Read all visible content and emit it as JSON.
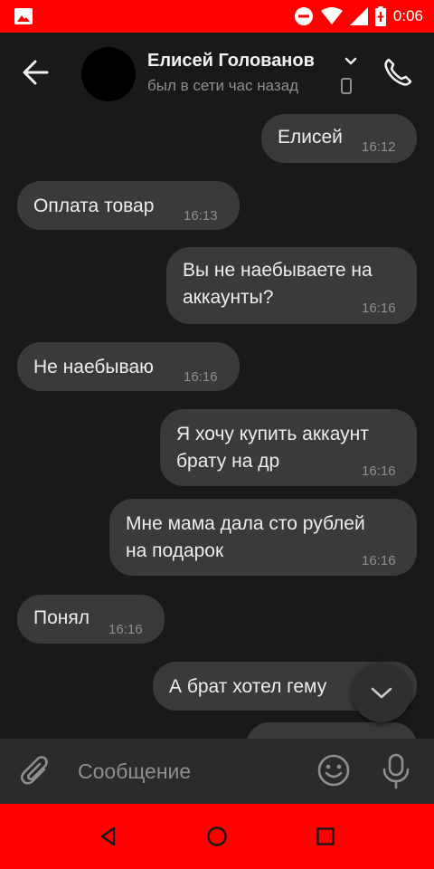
{
  "status_bar": {
    "time": "0:06",
    "icons": [
      "gallery-icon",
      "do-not-disturb-icon",
      "wifi-icon",
      "signal-icon",
      "battery-icon"
    ]
  },
  "header": {
    "contact_name": "Елисей Голованов",
    "contact_status": "был в сети час назад",
    "icons": [
      "back-arrow-icon",
      "chevron-down-icon",
      "phone-device-icon",
      "call-icon"
    ]
  },
  "messages": [
    {
      "direction": "out",
      "lines": [
        "Елисей"
      ],
      "time": "16:12"
    },
    {
      "direction": "in",
      "lines": [
        "Оплата товар"
      ],
      "time": "16:13"
    },
    {
      "direction": "out",
      "lines": [
        "Вы не наебываете на",
        "аккаунты?"
      ],
      "time": "16:16"
    },
    {
      "direction": "in",
      "lines": [
        "Не наебываю"
      ],
      "time": "16:16"
    },
    {
      "direction": "out",
      "lines": [
        "Я хочу купить аккаунт",
        "брату на др"
      ],
      "time": "16:16"
    },
    {
      "direction": "out",
      "lines": [
        "Мне мама дала сто рублей",
        "на подарок"
      ],
      "time": "16:16"
    },
    {
      "direction": "in",
      "lines": [
        "Понял"
      ],
      "time": "16:16"
    },
    {
      "direction": "out",
      "lines": [
        "А брат хотел гему"
      ],
      "time": ""
    }
  ],
  "composer": {
    "placeholder": "Сообщение",
    "icons": [
      "paperclip-icon",
      "emoji-icon",
      "microphone-icon",
      "chevron-down-icon"
    ]
  },
  "nav_bar": {
    "icons": [
      "nav-back-icon",
      "nav-home-icon",
      "nav-recent-icon"
    ]
  },
  "colors": {
    "system_bars": "#ff0000",
    "background": "#19191a",
    "bubble": "#3a3a3c",
    "input_bar": "#2b2b2d",
    "secondary_text": "#8f8f91"
  }
}
